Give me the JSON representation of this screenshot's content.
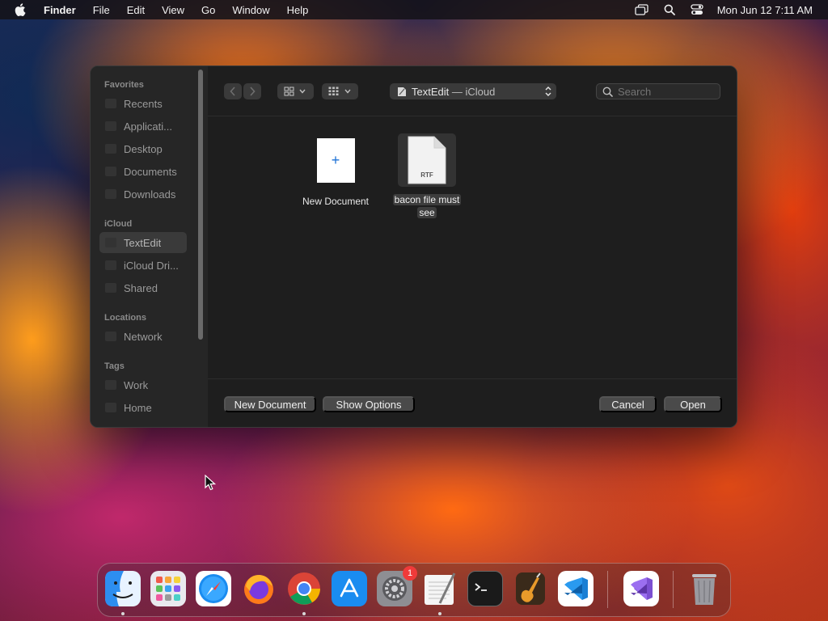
{
  "menubar": {
    "app_name": "Finder",
    "menus": [
      "File",
      "Edit",
      "View",
      "Go",
      "Window",
      "Help"
    ],
    "clock": "Mon Jun 12  7:11 AM",
    "status_icons": [
      "screen-mirroring-icon",
      "spotlight-search-icon",
      "control-center-icon"
    ]
  },
  "sidebar": {
    "favorites_title": "Favorites",
    "favorites": [
      "Recents",
      "Applicati...",
      "Desktop",
      "Documents",
      "Downloads"
    ],
    "icloud_title": "iCloud",
    "icloud": [
      "TextEdit",
      "iCloud Dri...",
      "Shared"
    ],
    "locations_title": "Locations",
    "locations": [
      "Network"
    ],
    "tags_title": "Tags",
    "tags": [
      "Work",
      "Home"
    ],
    "selected": "TextEdit"
  },
  "toolbar": {
    "location": {
      "name": "TextEdit",
      "separator": " — ",
      "container": "iCloud"
    },
    "search_placeholder": "Search",
    "icons": [
      "back-arrow-icon",
      "forward-arrow-icon",
      "icon-view-icon",
      "group-by-icon"
    ]
  },
  "files": [
    {
      "name": "New Document",
      "kind": "new",
      "icon": "plus-icon"
    },
    {
      "name": "bacon file must see",
      "kind": "RTF",
      "icon_label": "RTF",
      "selected": true
    }
  ],
  "footer": {
    "new_document": "New Document",
    "show_options": "Show Options",
    "cancel": "Cancel",
    "open": "Open"
  },
  "dock": {
    "apps": [
      "Finder",
      "Launchpad",
      "Safari",
      "Firefox",
      "Google Chrome",
      "App Store",
      "System Settings",
      "TextEdit",
      "Terminal",
      "GarageBand",
      "Visual Studio Code",
      "Visual Studio",
      "Trash"
    ],
    "running": [
      "Finder",
      "Google Chrome",
      "TextEdit"
    ],
    "system_settings_badge": "1"
  }
}
